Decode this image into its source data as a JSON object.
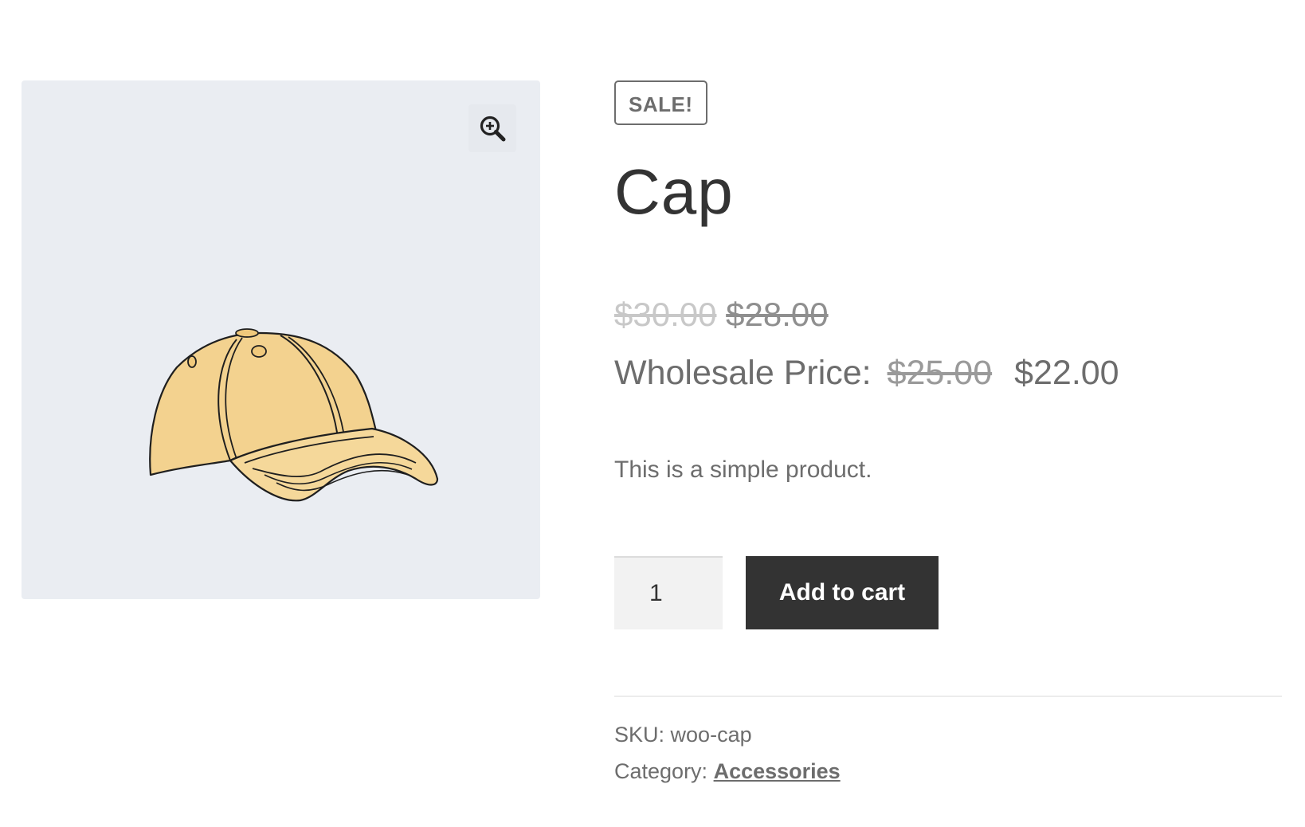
{
  "badge": {
    "sale_label": "SALE!"
  },
  "product": {
    "title": "Cap",
    "description": "This is a simple product.",
    "image_alt": "Cap"
  },
  "pricing": {
    "regular_price": "$30.00",
    "sale_price": "$28.00",
    "wholesale_label": "Wholesale Price:",
    "wholesale_old": "$25.00",
    "wholesale_new": "$22.00"
  },
  "cart": {
    "quantity": "1",
    "add_label": "Add to cart"
  },
  "meta": {
    "sku_label": "SKU:",
    "sku_value": "woo-cap",
    "category_label": "Category:",
    "category_value": "Accessories"
  },
  "icons": {
    "zoom": "zoom-in-icon"
  },
  "colors": {
    "button_bg": "#333333",
    "gallery_bg": "#eaedf2",
    "cap_fill": "#f3d28f"
  }
}
